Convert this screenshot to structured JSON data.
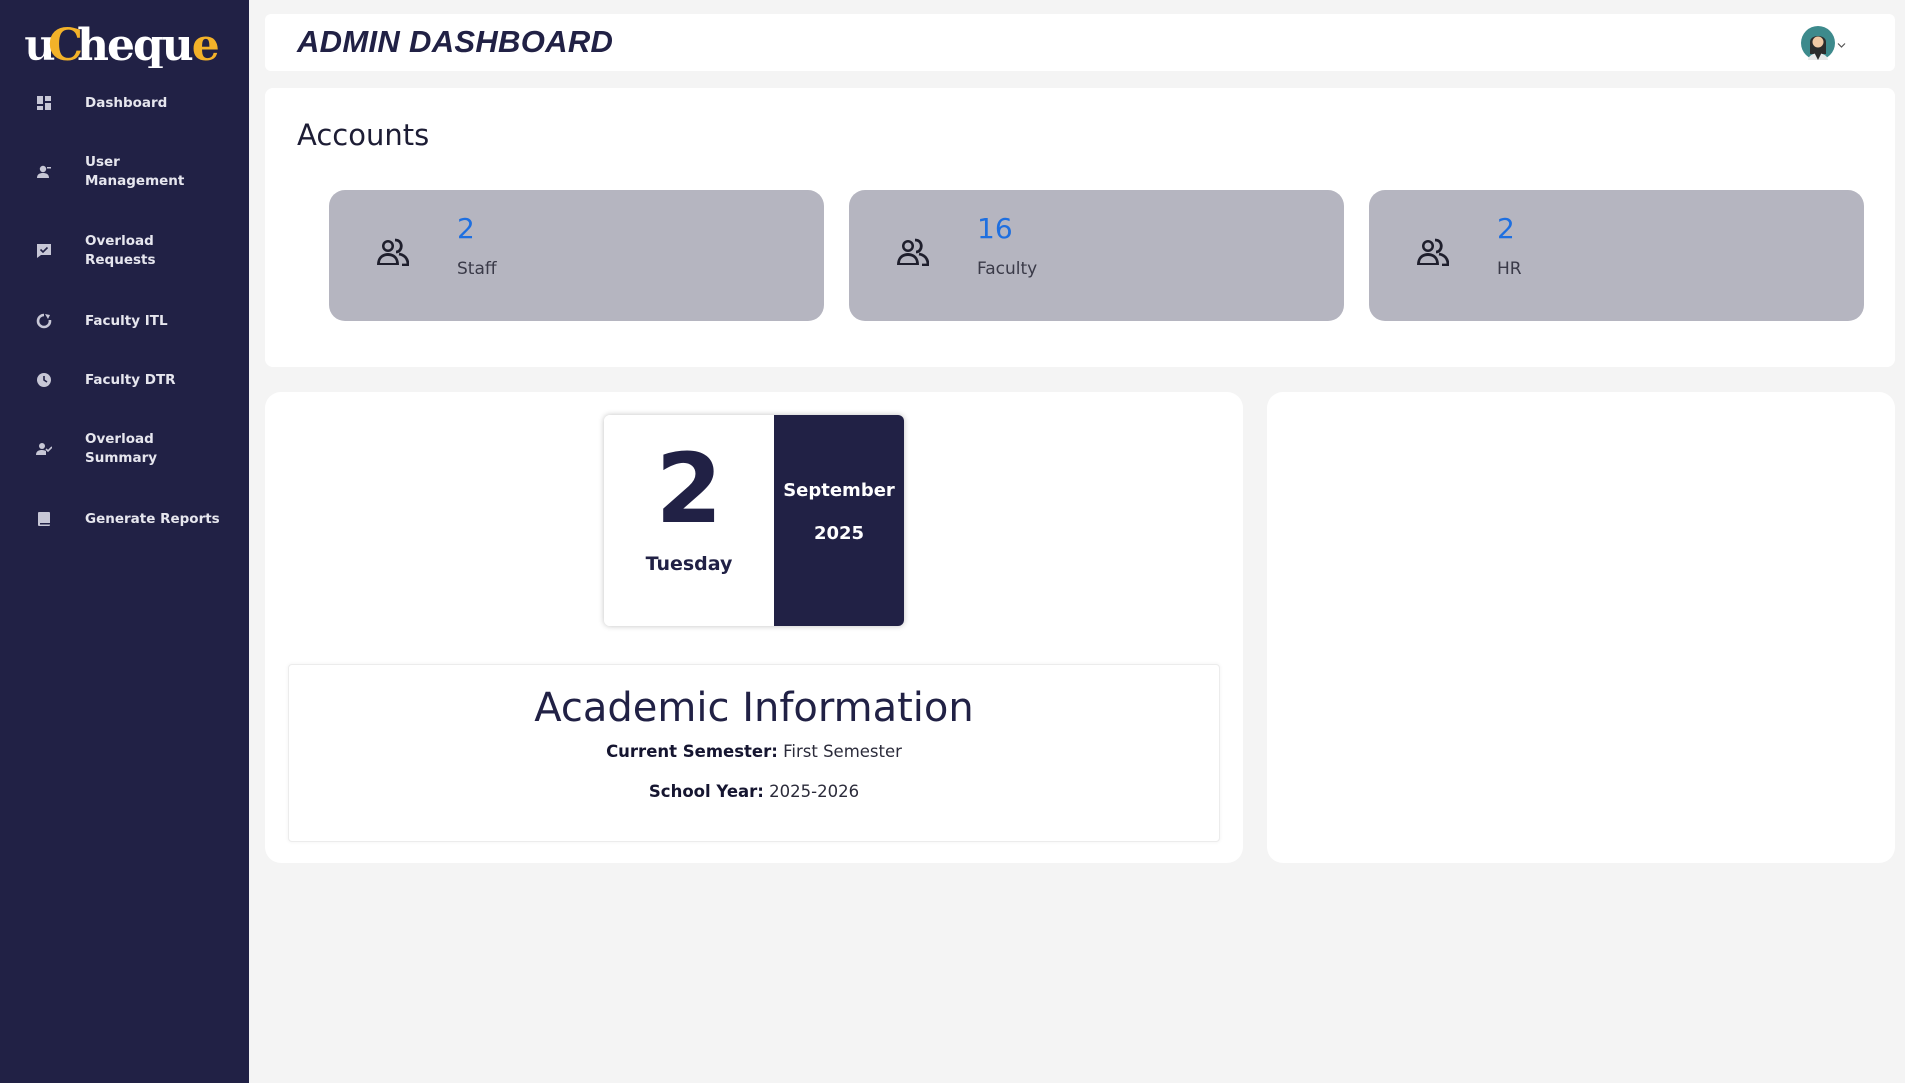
{
  "app": {
    "logo": "uCheque",
    "logo_parts": [
      "u",
      "Cheq",
      "u",
      "e"
    ]
  },
  "sidebar": {
    "items": [
      {
        "label": "Dashboard",
        "icon": "dashboard-icon"
      },
      {
        "label": "User\nManagement",
        "icon": "user-icon"
      },
      {
        "label": "Overload\nRequests",
        "icon": "check-message-icon"
      },
      {
        "label": "Faculty ITL",
        "icon": "refresh-circle-icon"
      },
      {
        "label": "Faculty DTR",
        "icon": "clock-icon"
      },
      {
        "label": "Overload\nSummary",
        "icon": "user-check-icon"
      },
      {
        "label": "Generate Reports",
        "icon": "book-icon"
      }
    ]
  },
  "header": {
    "title": "ADMIN DASHBOARD",
    "avatar_icon": "user-avatar",
    "dropdown_icon": "chevron-down-icon"
  },
  "accounts": {
    "title": "Accounts",
    "cards": [
      {
        "value": "2",
        "label": "Staff",
        "icon": "users-icon"
      },
      {
        "value": "16",
        "label": "Faculty",
        "icon": "users-icon"
      },
      {
        "value": "2",
        "label": "HR",
        "icon": "users-icon"
      }
    ]
  },
  "calendar": {
    "day": "2",
    "weekday": "Tuesday",
    "month": "September",
    "year": "2025"
  },
  "academic": {
    "title": "Academic Information",
    "semester_label": "Current Semester:",
    "semester_value": "First Semester",
    "year_label": "School Year:",
    "year_value": "2025-2026"
  },
  "colors": {
    "sidebar_bg": "#212145",
    "accent_gold": "#f3b229",
    "stat_value": "#1e6fe0",
    "card_bg": "#b5b5c0"
  }
}
